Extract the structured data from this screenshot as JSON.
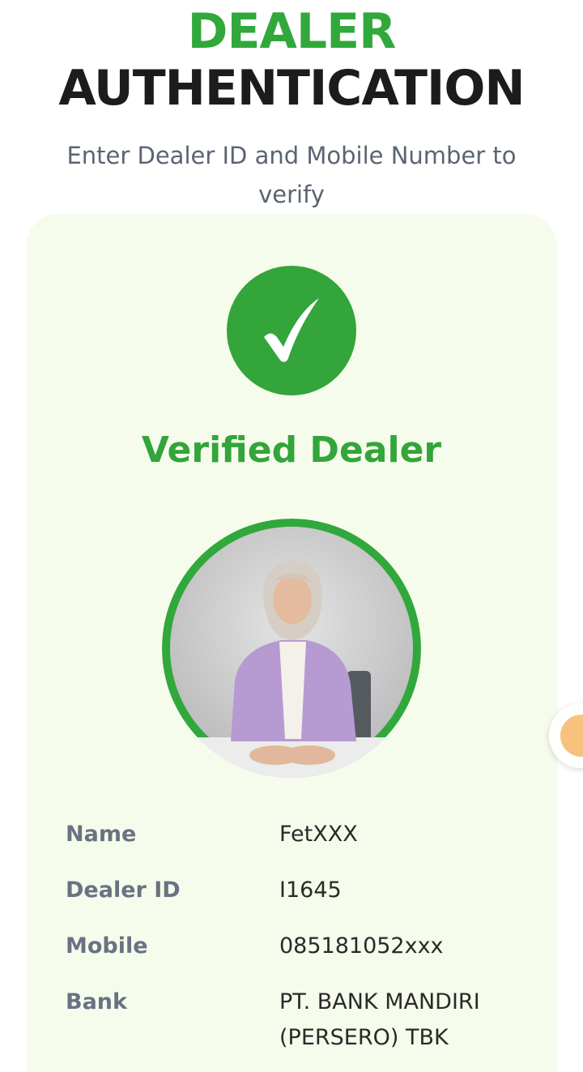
{
  "header": {
    "title_line1": "DEALER",
    "title_line2": "AUTHENTICATION",
    "subtitle": "Enter Dealer ID and Mobile Number to verify"
  },
  "result": {
    "status_icon": "checkmark-icon",
    "status_text": "Verified Dealer",
    "photo_icon": "dealer-photo"
  },
  "details": [
    {
      "label": "Name",
      "value": "FetXXX"
    },
    {
      "label": "Dealer ID",
      "value": "I1645"
    },
    {
      "label": "Mobile",
      "value": "085181052xxx"
    },
    {
      "label": "Bank",
      "value": "PT. BANK MANDIRI (PERSERO) TBK"
    }
  ],
  "colors": {
    "brand_green": "#33a53a",
    "card_background": "#f6fcec",
    "heading_dark": "#1c1c1c",
    "label_gray": "#6a7282"
  },
  "floating_button": {
    "icon": "float-action-icon"
  }
}
